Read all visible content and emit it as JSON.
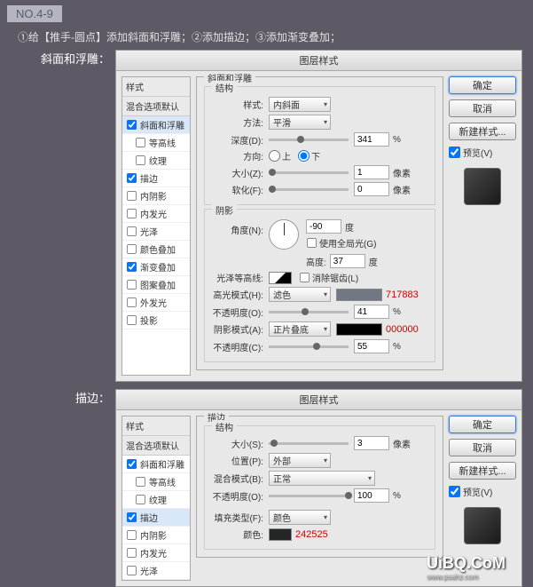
{
  "tag": "NO.4-9",
  "instruction": "①给【推手-圆点】添加斜面和浮雕；②添加描边；③添加渐变叠加；",
  "section1_label": "斜面和浮雕：",
  "section2_label": "描边：",
  "dialog_title": "图层样式",
  "style_list": {
    "header": "样式",
    "blend": "混合选项默认",
    "items": [
      {
        "label": "斜面和浮雕",
        "checked": true
      },
      {
        "label": "等高线",
        "checked": false,
        "sub": true
      },
      {
        "label": "纹理",
        "checked": false,
        "sub": true
      },
      {
        "label": "描边",
        "checked": true
      },
      {
        "label": "内阴影",
        "checked": false
      },
      {
        "label": "内发光",
        "checked": false
      },
      {
        "label": "光泽",
        "checked": false
      },
      {
        "label": "颜色叠加",
        "checked": false
      },
      {
        "label": "渐变叠加",
        "checked": true
      },
      {
        "label": "图案叠加",
        "checked": false
      },
      {
        "label": "外发光",
        "checked": false
      },
      {
        "label": "投影",
        "checked": false
      }
    ]
  },
  "bevel": {
    "group_title": "斜面和浮雕",
    "struct_title": "结构",
    "style_label": "样式:",
    "style_value": "内斜面",
    "method_label": "方法:",
    "method_value": "平滑",
    "depth_label": "深度(D):",
    "depth_value": "341",
    "depth_unit": "%",
    "dir_label": "方向:",
    "dir_up": "上",
    "dir_down": "下",
    "size_label": "大小(Z):",
    "size_value": "1",
    "size_unit": "像素",
    "soften_label": "软化(F):",
    "soften_value": "0",
    "soften_unit": "像素",
    "shade_title": "阴影",
    "angle_label": "角度(N):",
    "angle_value": "-90",
    "angle_unit": "度",
    "global_label": "使用全局光(G)",
    "alt_label": "高度:",
    "alt_value": "37",
    "alt_unit": "度",
    "contour_label": "光泽等高线:",
    "antialias_label": "消除锯齿(L)",
    "hl_mode_label": "高光模式(H):",
    "hl_mode_value": "滤色",
    "hl_color": "#717883",
    "hl_hex": "717883",
    "opacity1_label": "不透明度(O):",
    "opacity1_value": "41",
    "opacity_unit": "%",
    "sh_mode_label": "阴影模式(A):",
    "sh_mode_value": "正片叠底",
    "sh_color": "#000000",
    "sh_hex": "000000",
    "opacity2_label": "不透明度(C):",
    "opacity2_value": "55"
  },
  "stroke": {
    "group_title": "描边",
    "struct_title": "结构",
    "size_label": "大小(S):",
    "size_value": "3",
    "size_unit": "像素",
    "pos_label": "位置(P):",
    "pos_value": "外部",
    "blend_label": "混合模式(B):",
    "blend_value": "正常",
    "opacity_label": "不透明度(O):",
    "opacity_value": "100",
    "opacity_unit": "%",
    "fill_label": "填充类型(F):",
    "fill_value": "颜色",
    "color_label": "颜色:",
    "color": "#242525",
    "color_hex": "242525"
  },
  "buttons": {
    "ok": "确定",
    "cancel": "取消",
    "new_style": "新建样式...",
    "preview": "预览(V)"
  },
  "watermark": "UiBQ.CoM",
  "watermark_sub": "www.psahz.com"
}
